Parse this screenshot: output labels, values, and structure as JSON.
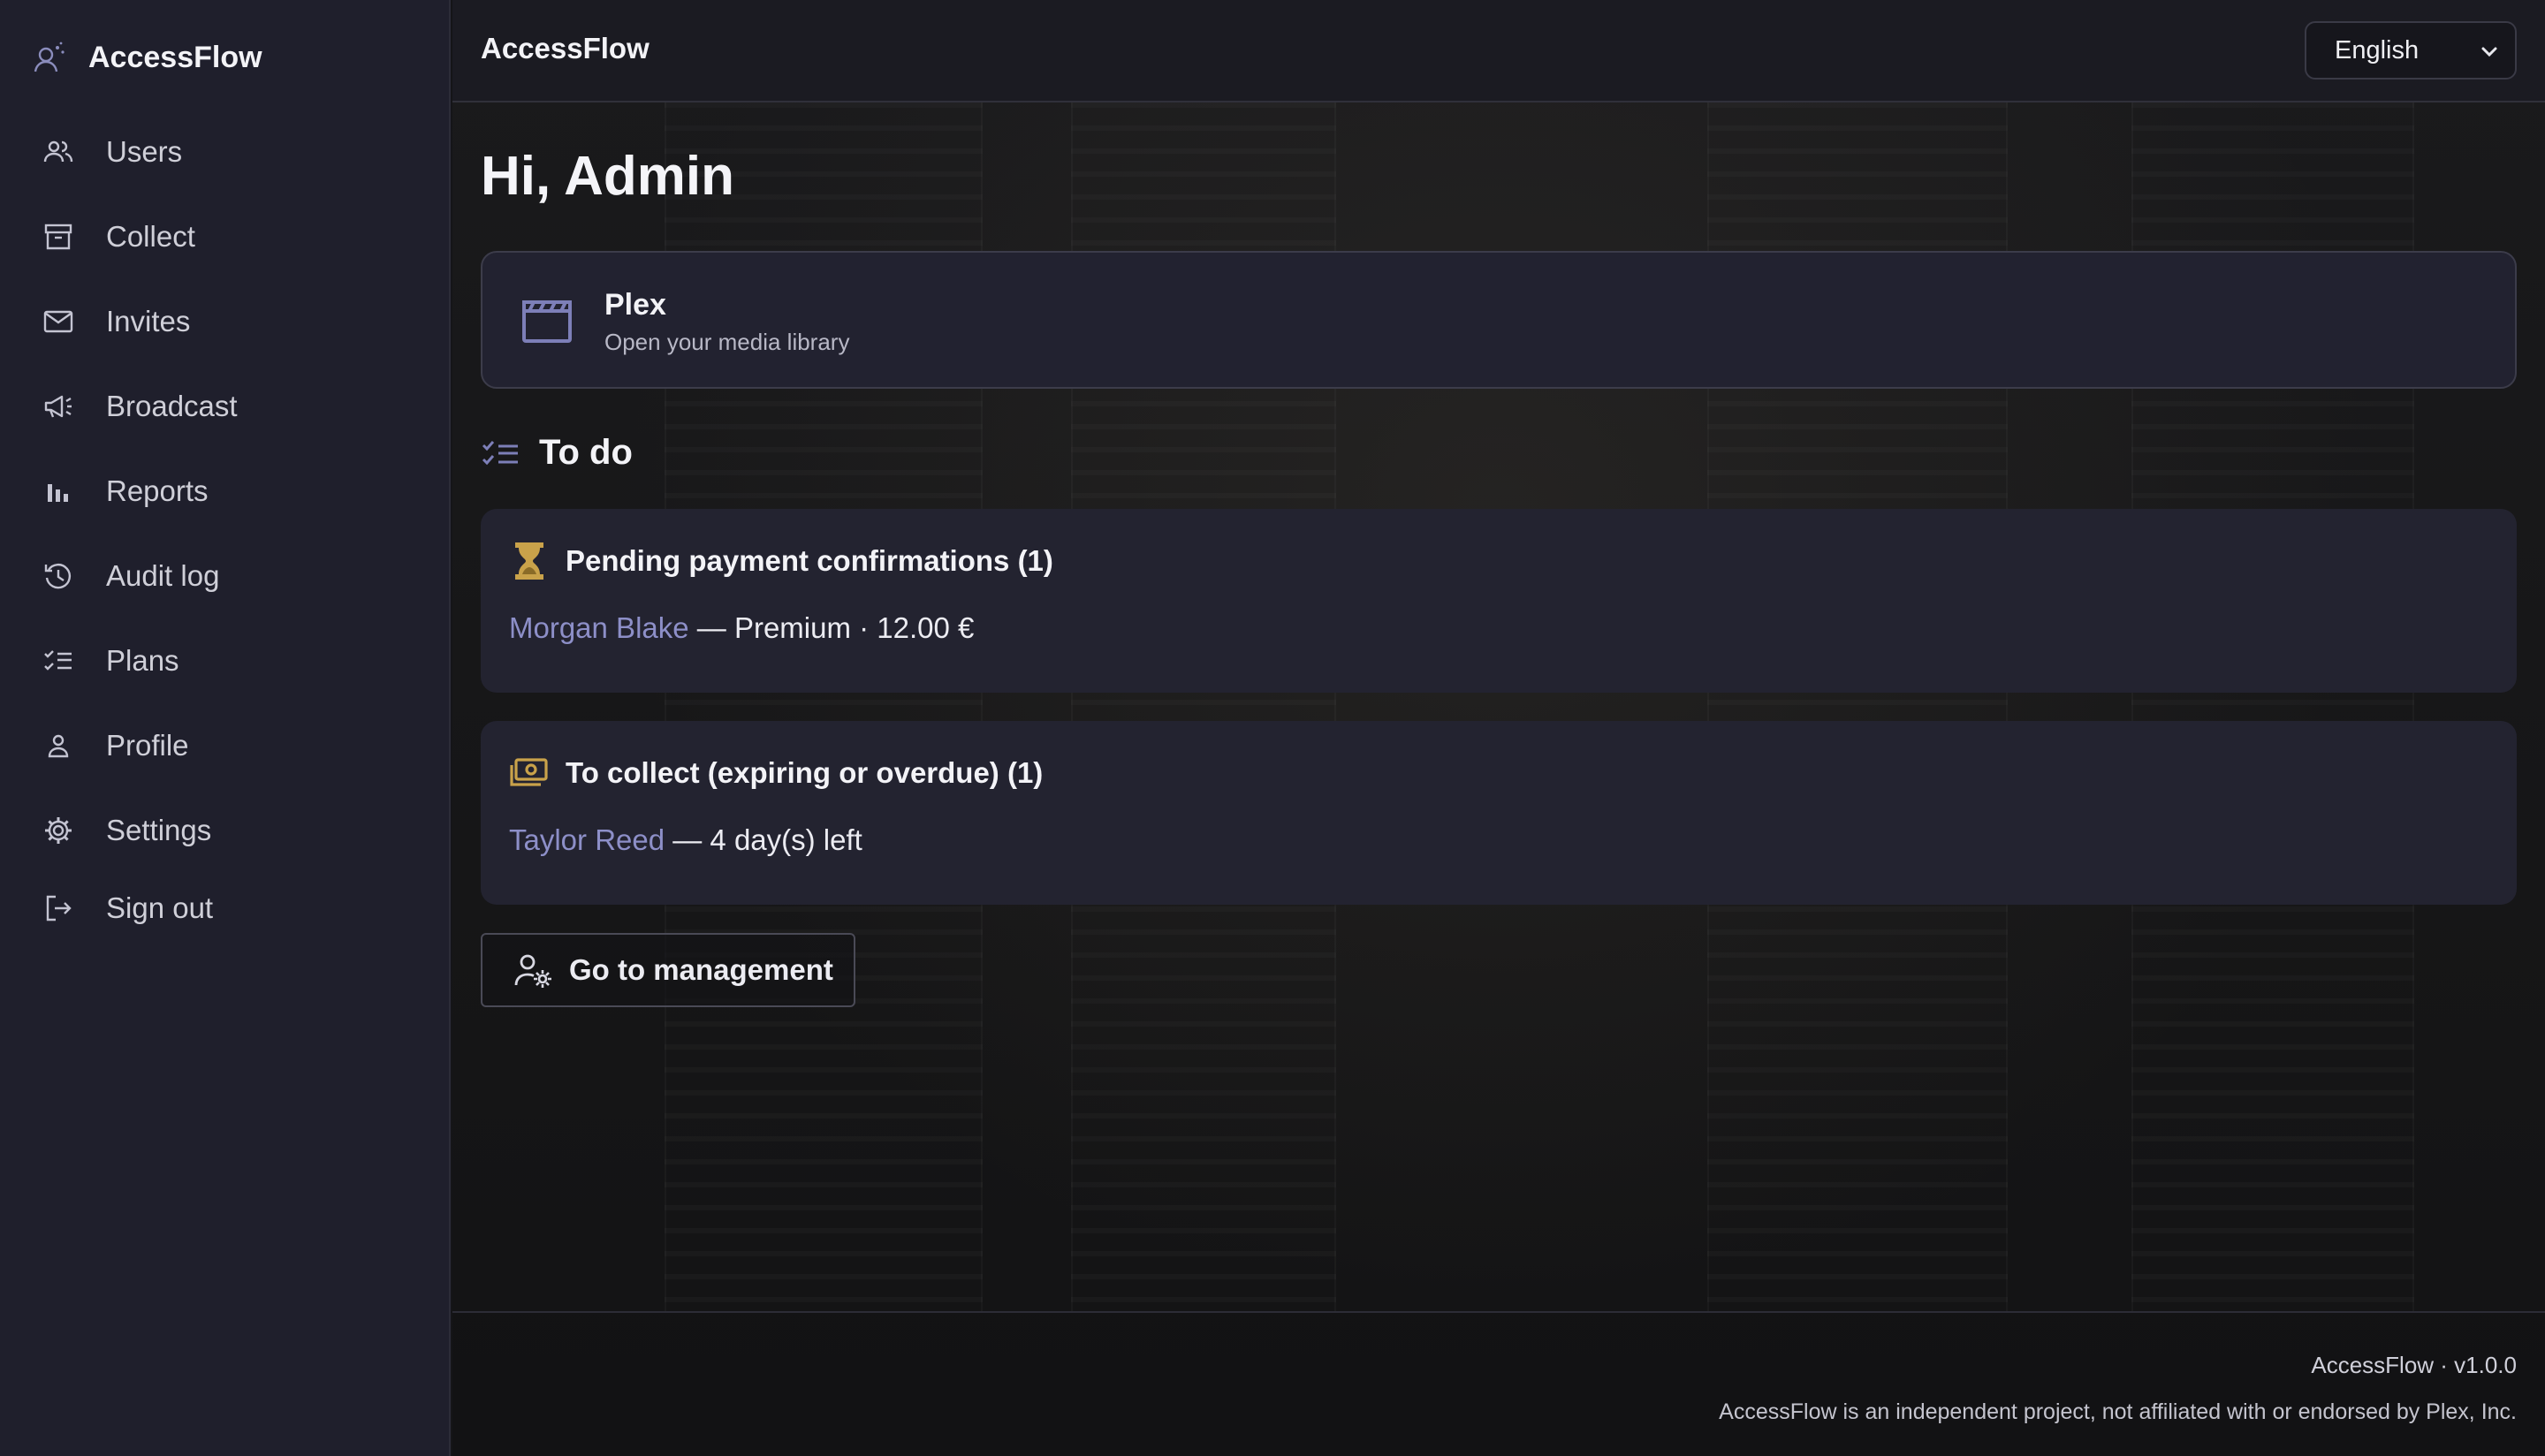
{
  "app": {
    "name": "AccessFlow"
  },
  "sidebar": {
    "items": [
      {
        "label": "Users",
        "icon": "users-icon"
      },
      {
        "label": "Collect",
        "icon": "archive-icon"
      },
      {
        "label": "Invites",
        "icon": "mail-icon"
      },
      {
        "label": "Broadcast",
        "icon": "megaphone-icon"
      },
      {
        "label": "Reports",
        "icon": "bar-chart-icon"
      },
      {
        "label": "Audit log",
        "icon": "history-icon"
      },
      {
        "label": "Plans",
        "icon": "checklist-icon"
      },
      {
        "label": "Profile",
        "icon": "user-icon"
      },
      {
        "label": "Settings",
        "icon": "gear-icon"
      },
      {
        "label": "Sign out",
        "icon": "logout-icon"
      }
    ]
  },
  "header": {
    "title": "AccessFlow",
    "language": "English"
  },
  "main": {
    "greeting": "Hi, Admin",
    "plex": {
      "name": "Plex",
      "description": "Open your media library"
    },
    "todo_title": "To do",
    "pending": {
      "title": "Pending payment confirmations (1)",
      "user": "Morgan Blake",
      "detail": " — Premium · 12.00 €"
    },
    "collect": {
      "title": "To collect (expiring or overdue) (1)",
      "user": "Taylor Reed",
      "detail": " — 4 day(s) left"
    },
    "manage_button": "Go to management"
  },
  "footer": {
    "version": "AccessFlow · v1.0.0",
    "disclaimer": "AccessFlow is an independent project, not affiliated with or endorsed by Plex, Inc."
  },
  "colors": {
    "sidebar_bg": "#1f1f2c",
    "card_bg": "#232330",
    "link": "#8d8fc8",
    "accent_gold": "#c9a24a",
    "icon_muted": "#7d7fb8"
  }
}
